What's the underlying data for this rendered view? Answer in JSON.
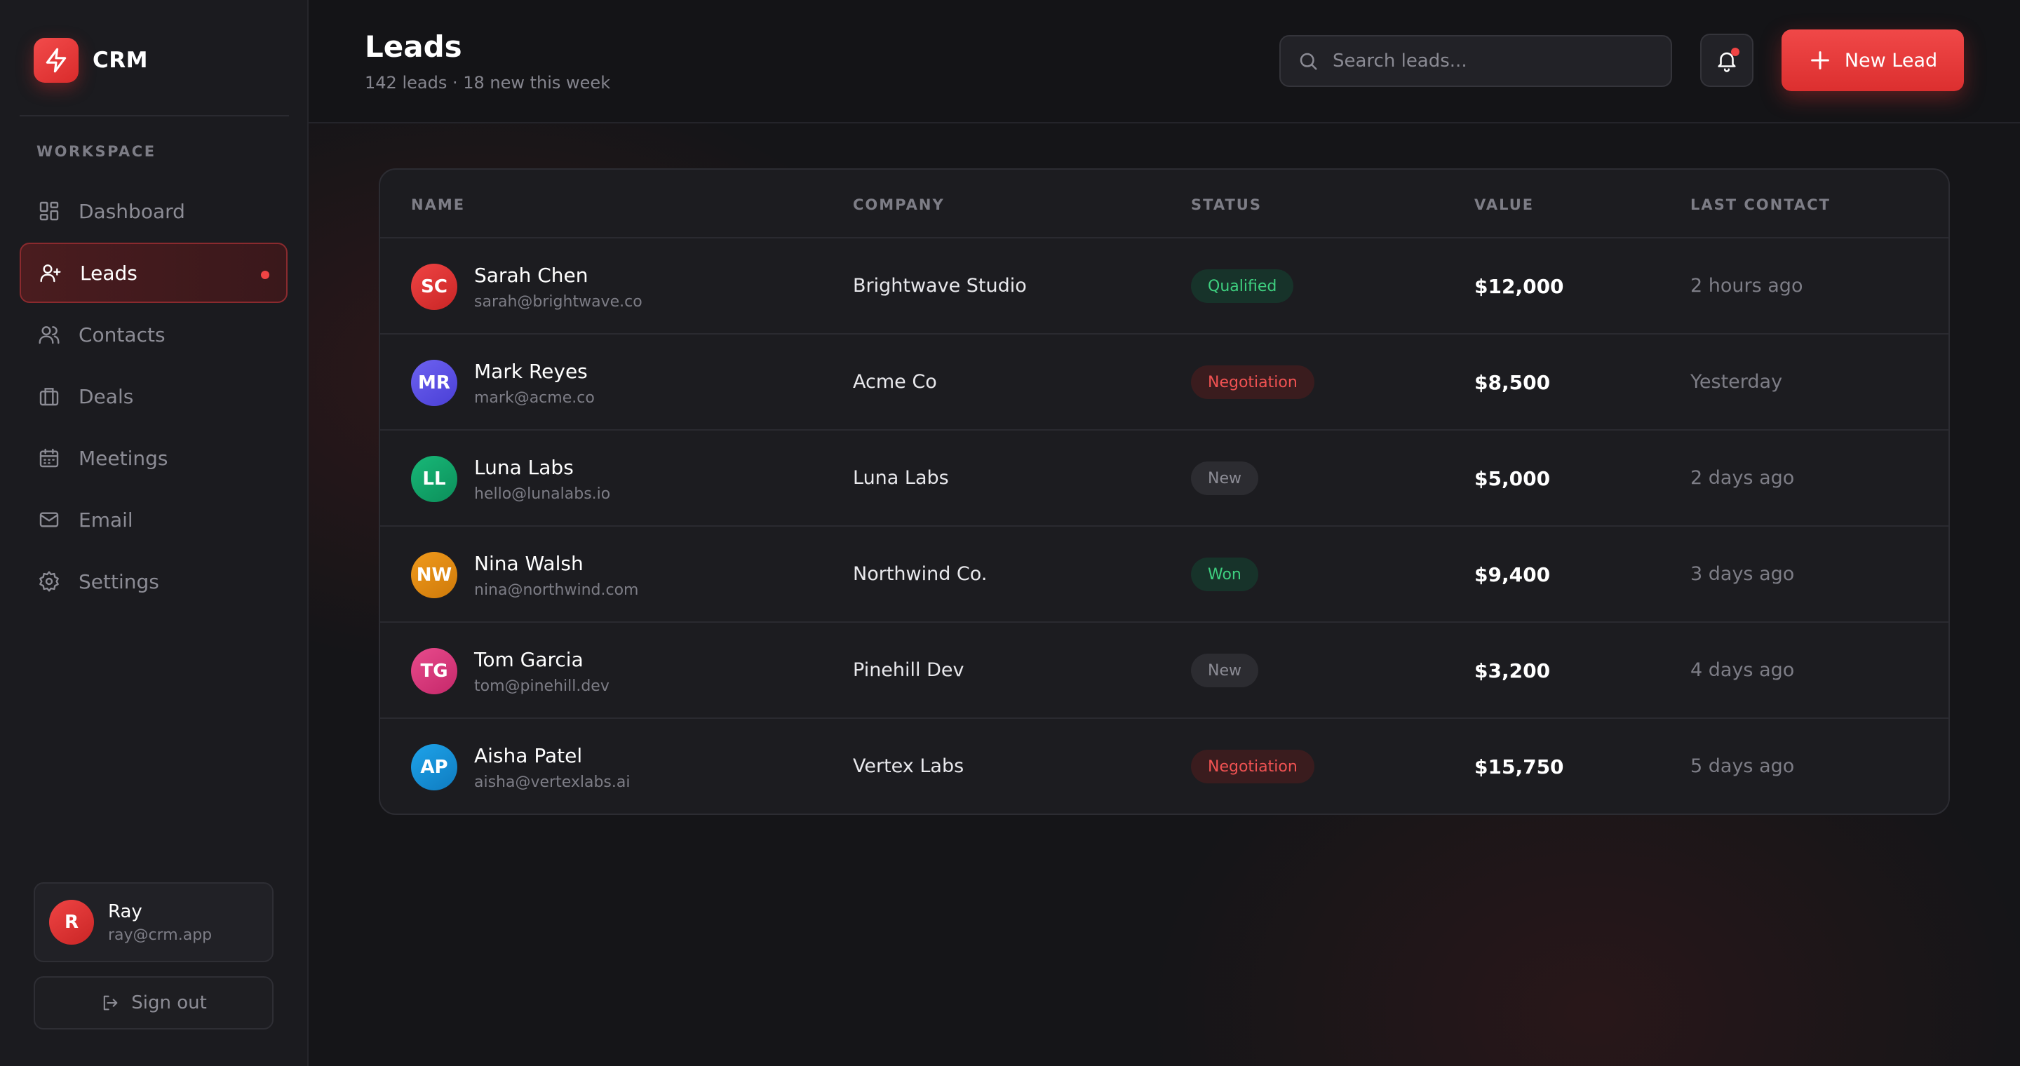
{
  "brand": {
    "name": "CRM"
  },
  "sidebar": {
    "section_label": "WORKSPACE",
    "items": [
      {
        "label": "Dashboard",
        "icon": "grid-icon"
      },
      {
        "label": "Leads",
        "icon": "user-plus-icon"
      },
      {
        "label": "Contacts",
        "icon": "users-icon"
      },
      {
        "label": "Deals",
        "icon": "briefcase-icon"
      },
      {
        "label": "Meetings",
        "icon": "calendar-icon"
      },
      {
        "label": "Email",
        "icon": "mail-icon"
      },
      {
        "label": "Settings",
        "icon": "gear-icon"
      }
    ],
    "active_item": "Leads"
  },
  "user": {
    "initial": "R",
    "name": "Ray",
    "email": "ray@crm.app"
  },
  "signout": {
    "label": "Sign out"
  },
  "header": {
    "title": "Leads",
    "subtitle": "142 leads · 18 new this week",
    "search_placeholder": "Search leads...",
    "new_button_label": "New Lead"
  },
  "table": {
    "columns": [
      "NAME",
      "COMPANY",
      "STATUS",
      "VALUE",
      "LAST CONTACT"
    ],
    "rows": [
      {
        "initials": "SC",
        "name": "Sarah Chen",
        "email": "sarah@brightwave.co",
        "company": "Brightwave Studio",
        "status": "Qualified",
        "status_type": "qualified",
        "value": "$12,000",
        "last_contact": "2 hours ago",
        "avatar_color": "#dc2f2f"
      },
      {
        "initials": "MR",
        "name": "Mark Reyes",
        "email": "mark@acme.co",
        "company": "Acme Co",
        "status": "Negotiation",
        "status_type": "negotiation",
        "value": "$8,500",
        "last_contact": "Yesterday",
        "avatar_color": "#5b4fe6"
      },
      {
        "initials": "LL",
        "name": "Luna Labs",
        "email": "hello@lunalabs.io",
        "company": "Luna Labs",
        "status": "New",
        "status_type": "new",
        "value": "$5,000",
        "last_contact": "2 days ago",
        "avatar_color": "#10a56a"
      },
      {
        "initials": "NW",
        "name": "Nina Walsh",
        "email": "nina@northwind.com",
        "company": "Northwind Co.",
        "status": "Won",
        "status_type": "won",
        "value": "$9,400",
        "last_contact": "3 days ago",
        "avatar_color": "#e08a12"
      },
      {
        "initials": "TG",
        "name": "Tom Garcia",
        "email": "tom@pinehill.dev",
        "company": "Pinehill Dev",
        "status": "New",
        "status_type": "new",
        "value": "$3,200",
        "last_contact": "4 days ago",
        "avatar_color": "#db3a7e"
      },
      {
        "initials": "AP",
        "name": "Aisha Patel",
        "email": "aisha@vertexlabs.ai",
        "company": "Vertex Labs",
        "status": "Negotiation",
        "status_type": "negotiation",
        "value": "$15,750",
        "last_contact": "5 days ago",
        "avatar_color": "#168fd6"
      }
    ]
  },
  "colors": {
    "accent": "#ef4444",
    "background": "#151518",
    "sidebar": "#1b1b1f"
  }
}
